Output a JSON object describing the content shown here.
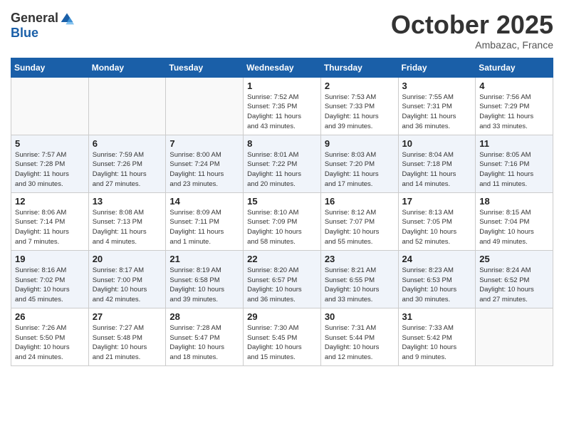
{
  "header": {
    "logo_general": "General",
    "logo_blue": "Blue",
    "month": "October 2025",
    "location": "Ambazac, France"
  },
  "weekdays": [
    "Sunday",
    "Monday",
    "Tuesday",
    "Wednesday",
    "Thursday",
    "Friday",
    "Saturday"
  ],
  "weeks": [
    [
      {
        "day": "",
        "info": ""
      },
      {
        "day": "",
        "info": ""
      },
      {
        "day": "",
        "info": ""
      },
      {
        "day": "1",
        "info": "Sunrise: 7:52 AM\nSunset: 7:35 PM\nDaylight: 11 hours\nand 43 minutes."
      },
      {
        "day": "2",
        "info": "Sunrise: 7:53 AM\nSunset: 7:33 PM\nDaylight: 11 hours\nand 39 minutes."
      },
      {
        "day": "3",
        "info": "Sunrise: 7:55 AM\nSunset: 7:31 PM\nDaylight: 11 hours\nand 36 minutes."
      },
      {
        "day": "4",
        "info": "Sunrise: 7:56 AM\nSunset: 7:29 PM\nDaylight: 11 hours\nand 33 minutes."
      }
    ],
    [
      {
        "day": "5",
        "info": "Sunrise: 7:57 AM\nSunset: 7:28 PM\nDaylight: 11 hours\nand 30 minutes."
      },
      {
        "day": "6",
        "info": "Sunrise: 7:59 AM\nSunset: 7:26 PM\nDaylight: 11 hours\nand 27 minutes."
      },
      {
        "day": "7",
        "info": "Sunrise: 8:00 AM\nSunset: 7:24 PM\nDaylight: 11 hours\nand 23 minutes."
      },
      {
        "day": "8",
        "info": "Sunrise: 8:01 AM\nSunset: 7:22 PM\nDaylight: 11 hours\nand 20 minutes."
      },
      {
        "day": "9",
        "info": "Sunrise: 8:03 AM\nSunset: 7:20 PM\nDaylight: 11 hours\nand 17 minutes."
      },
      {
        "day": "10",
        "info": "Sunrise: 8:04 AM\nSunset: 7:18 PM\nDaylight: 11 hours\nand 14 minutes."
      },
      {
        "day": "11",
        "info": "Sunrise: 8:05 AM\nSunset: 7:16 PM\nDaylight: 11 hours\nand 11 minutes."
      }
    ],
    [
      {
        "day": "12",
        "info": "Sunrise: 8:06 AM\nSunset: 7:14 PM\nDaylight: 11 hours\nand 7 minutes."
      },
      {
        "day": "13",
        "info": "Sunrise: 8:08 AM\nSunset: 7:13 PM\nDaylight: 11 hours\nand 4 minutes."
      },
      {
        "day": "14",
        "info": "Sunrise: 8:09 AM\nSunset: 7:11 PM\nDaylight: 11 hours\nand 1 minute."
      },
      {
        "day": "15",
        "info": "Sunrise: 8:10 AM\nSunset: 7:09 PM\nDaylight: 10 hours\nand 58 minutes."
      },
      {
        "day": "16",
        "info": "Sunrise: 8:12 AM\nSunset: 7:07 PM\nDaylight: 10 hours\nand 55 minutes."
      },
      {
        "day": "17",
        "info": "Sunrise: 8:13 AM\nSunset: 7:05 PM\nDaylight: 10 hours\nand 52 minutes."
      },
      {
        "day": "18",
        "info": "Sunrise: 8:15 AM\nSunset: 7:04 PM\nDaylight: 10 hours\nand 49 minutes."
      }
    ],
    [
      {
        "day": "19",
        "info": "Sunrise: 8:16 AM\nSunset: 7:02 PM\nDaylight: 10 hours\nand 45 minutes."
      },
      {
        "day": "20",
        "info": "Sunrise: 8:17 AM\nSunset: 7:00 PM\nDaylight: 10 hours\nand 42 minutes."
      },
      {
        "day": "21",
        "info": "Sunrise: 8:19 AM\nSunset: 6:58 PM\nDaylight: 10 hours\nand 39 minutes."
      },
      {
        "day": "22",
        "info": "Sunrise: 8:20 AM\nSunset: 6:57 PM\nDaylight: 10 hours\nand 36 minutes."
      },
      {
        "day": "23",
        "info": "Sunrise: 8:21 AM\nSunset: 6:55 PM\nDaylight: 10 hours\nand 33 minutes."
      },
      {
        "day": "24",
        "info": "Sunrise: 8:23 AM\nSunset: 6:53 PM\nDaylight: 10 hours\nand 30 minutes."
      },
      {
        "day": "25",
        "info": "Sunrise: 8:24 AM\nSunset: 6:52 PM\nDaylight: 10 hours\nand 27 minutes."
      }
    ],
    [
      {
        "day": "26",
        "info": "Sunrise: 7:26 AM\nSunset: 5:50 PM\nDaylight: 10 hours\nand 24 minutes."
      },
      {
        "day": "27",
        "info": "Sunrise: 7:27 AM\nSunset: 5:48 PM\nDaylight: 10 hours\nand 21 minutes."
      },
      {
        "day": "28",
        "info": "Sunrise: 7:28 AM\nSunset: 5:47 PM\nDaylight: 10 hours\nand 18 minutes."
      },
      {
        "day": "29",
        "info": "Sunrise: 7:30 AM\nSunset: 5:45 PM\nDaylight: 10 hours\nand 15 minutes."
      },
      {
        "day": "30",
        "info": "Sunrise: 7:31 AM\nSunset: 5:44 PM\nDaylight: 10 hours\nand 12 minutes."
      },
      {
        "day": "31",
        "info": "Sunrise: 7:33 AM\nSunset: 5:42 PM\nDaylight: 10 hours\nand 9 minutes."
      },
      {
        "day": "",
        "info": ""
      }
    ]
  ]
}
